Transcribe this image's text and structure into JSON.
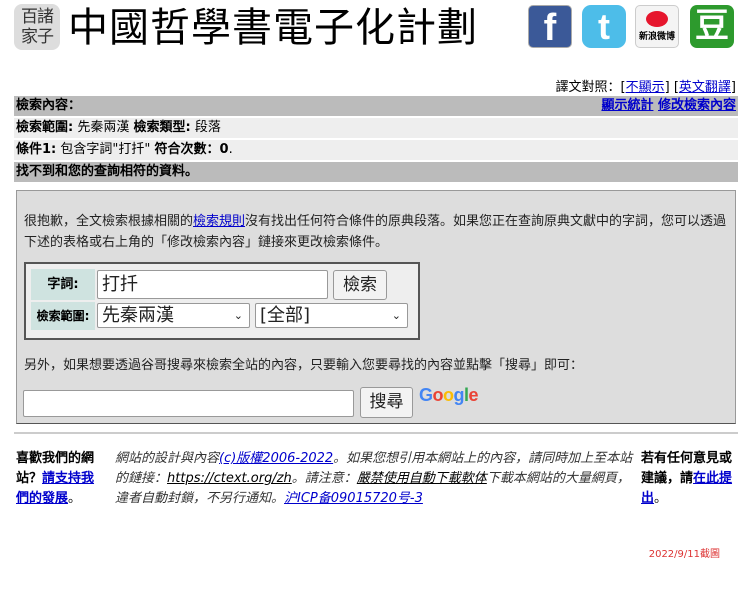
{
  "header": {
    "logo_text": "百諸家子",
    "title": "中國哲學書電子化計劃",
    "social": [
      {
        "name": "facebook",
        "glyph": "f"
      },
      {
        "name": "twitter",
        "glyph": "t"
      },
      {
        "name": "weibo",
        "label": "新浪微博"
      },
      {
        "name": "douban",
        "glyph": "豆"
      }
    ]
  },
  "translation": {
    "label": "譯文對照：",
    "hide": "不顯示",
    "english": "英文翻譯"
  },
  "summary": {
    "search_content_label": "檢索內容：",
    "show_stats": "顯示統計",
    "modify": "修改檢索內容",
    "scope_label": "檢索範圍:",
    "scope_value": "先秦兩漢",
    "type_label": "檢索類型:",
    "type_value": "段落",
    "cond_label": "條件1:",
    "cond_text": "包含字詞\"打扦\"",
    "match_label": "符合次數：",
    "match_value": "0",
    "no_results": "找不到和您的查詢相符的資料。"
  },
  "box": {
    "sorry_pre": "很抱歉，全文檢索根據相關的",
    "rules_link": "檢索規則",
    "sorry_post": "沒有找出任何符合條件的原典段落。如果您正在查詢原典文獻中的字詞，您可以透過下述的表格或右上角的「修改檢索內容」鏈接來更改檢索條件。",
    "form": {
      "term_label": "字詞:",
      "term_value": "打扦",
      "search_button": "檢索",
      "scope_label": "檢索範圍:",
      "scope_selected": "先秦兩漢",
      "sub_selected": "[全部]"
    },
    "google_text": "另外，如果想要透過谷哥搜尋來檢索全站的內容，只要輸入您要尋找的內容並點擊「搜尋」即可：",
    "google_value": "",
    "google_button": "搜尋",
    "google_logo": "Google"
  },
  "footer": {
    "col1_pre": "喜歡我們的網站？",
    "col1_link": "請支持我們的發展",
    "col1_post": "。",
    "col2_a": "網站的設計與內容",
    "col2_copy": "(c)版權2006-2022",
    "col2_b": "。如果您想引用本網站上的內容，請同時加上至本站的鏈接：",
    "col2_url": "https://ctext.org/zh",
    "col2_c": "。請注意：",
    "col2_warn": "嚴禁使用自動下載軟体",
    "col2_d": "下載本網站的大量網頁，違者自動封鎖，不另行通知。",
    "col2_icp": "沪ICP备09015720号-3",
    "col3_pre": "若有任何意見或建議，請",
    "col3_link": "在此提出",
    "col3_post": "。"
  },
  "screenshot_date": "2022/9/11截圖"
}
